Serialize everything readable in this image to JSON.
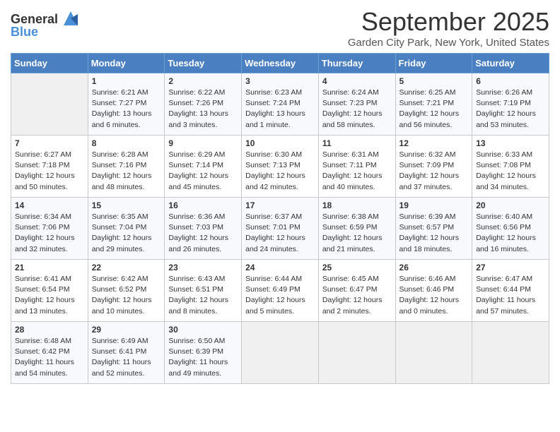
{
  "logo": {
    "general": "General",
    "blue": "Blue"
  },
  "header": {
    "month": "September 2025",
    "location": "Garden City Park, New York, United States"
  },
  "days_of_week": [
    "Sunday",
    "Monday",
    "Tuesday",
    "Wednesday",
    "Thursday",
    "Friday",
    "Saturday"
  ],
  "weeks": [
    [
      {
        "day": "",
        "info": ""
      },
      {
        "day": "1",
        "info": "Sunrise: 6:21 AM\nSunset: 7:27 PM\nDaylight: 13 hours\nand 6 minutes."
      },
      {
        "day": "2",
        "info": "Sunrise: 6:22 AM\nSunset: 7:26 PM\nDaylight: 13 hours\nand 3 minutes."
      },
      {
        "day": "3",
        "info": "Sunrise: 6:23 AM\nSunset: 7:24 PM\nDaylight: 13 hours\nand 1 minute."
      },
      {
        "day": "4",
        "info": "Sunrise: 6:24 AM\nSunset: 7:23 PM\nDaylight: 12 hours\nand 58 minutes."
      },
      {
        "day": "5",
        "info": "Sunrise: 6:25 AM\nSunset: 7:21 PM\nDaylight: 12 hours\nand 56 minutes."
      },
      {
        "day": "6",
        "info": "Sunrise: 6:26 AM\nSunset: 7:19 PM\nDaylight: 12 hours\nand 53 minutes."
      }
    ],
    [
      {
        "day": "7",
        "info": "Sunrise: 6:27 AM\nSunset: 7:18 PM\nDaylight: 12 hours\nand 50 minutes."
      },
      {
        "day": "8",
        "info": "Sunrise: 6:28 AM\nSunset: 7:16 PM\nDaylight: 12 hours\nand 48 minutes."
      },
      {
        "day": "9",
        "info": "Sunrise: 6:29 AM\nSunset: 7:14 PM\nDaylight: 12 hours\nand 45 minutes."
      },
      {
        "day": "10",
        "info": "Sunrise: 6:30 AM\nSunset: 7:13 PM\nDaylight: 12 hours\nand 42 minutes."
      },
      {
        "day": "11",
        "info": "Sunrise: 6:31 AM\nSunset: 7:11 PM\nDaylight: 12 hours\nand 40 minutes."
      },
      {
        "day": "12",
        "info": "Sunrise: 6:32 AM\nSunset: 7:09 PM\nDaylight: 12 hours\nand 37 minutes."
      },
      {
        "day": "13",
        "info": "Sunrise: 6:33 AM\nSunset: 7:08 PM\nDaylight: 12 hours\nand 34 minutes."
      }
    ],
    [
      {
        "day": "14",
        "info": "Sunrise: 6:34 AM\nSunset: 7:06 PM\nDaylight: 12 hours\nand 32 minutes."
      },
      {
        "day": "15",
        "info": "Sunrise: 6:35 AM\nSunset: 7:04 PM\nDaylight: 12 hours\nand 29 minutes."
      },
      {
        "day": "16",
        "info": "Sunrise: 6:36 AM\nSunset: 7:03 PM\nDaylight: 12 hours\nand 26 minutes."
      },
      {
        "day": "17",
        "info": "Sunrise: 6:37 AM\nSunset: 7:01 PM\nDaylight: 12 hours\nand 24 minutes."
      },
      {
        "day": "18",
        "info": "Sunrise: 6:38 AM\nSunset: 6:59 PM\nDaylight: 12 hours\nand 21 minutes."
      },
      {
        "day": "19",
        "info": "Sunrise: 6:39 AM\nSunset: 6:57 PM\nDaylight: 12 hours\nand 18 minutes."
      },
      {
        "day": "20",
        "info": "Sunrise: 6:40 AM\nSunset: 6:56 PM\nDaylight: 12 hours\nand 16 minutes."
      }
    ],
    [
      {
        "day": "21",
        "info": "Sunrise: 6:41 AM\nSunset: 6:54 PM\nDaylight: 12 hours\nand 13 minutes."
      },
      {
        "day": "22",
        "info": "Sunrise: 6:42 AM\nSunset: 6:52 PM\nDaylight: 12 hours\nand 10 minutes."
      },
      {
        "day": "23",
        "info": "Sunrise: 6:43 AM\nSunset: 6:51 PM\nDaylight: 12 hours\nand 8 minutes."
      },
      {
        "day": "24",
        "info": "Sunrise: 6:44 AM\nSunset: 6:49 PM\nDaylight: 12 hours\nand 5 minutes."
      },
      {
        "day": "25",
        "info": "Sunrise: 6:45 AM\nSunset: 6:47 PM\nDaylight: 12 hours\nand 2 minutes."
      },
      {
        "day": "26",
        "info": "Sunrise: 6:46 AM\nSunset: 6:46 PM\nDaylight: 12 hours\nand 0 minutes."
      },
      {
        "day": "27",
        "info": "Sunrise: 6:47 AM\nSunset: 6:44 PM\nDaylight: 11 hours\nand 57 minutes."
      }
    ],
    [
      {
        "day": "28",
        "info": "Sunrise: 6:48 AM\nSunset: 6:42 PM\nDaylight: 11 hours\nand 54 minutes."
      },
      {
        "day": "29",
        "info": "Sunrise: 6:49 AM\nSunset: 6:41 PM\nDaylight: 11 hours\nand 52 minutes."
      },
      {
        "day": "30",
        "info": "Sunrise: 6:50 AM\nSunset: 6:39 PM\nDaylight: 11 hours\nand 49 minutes."
      },
      {
        "day": "",
        "info": ""
      },
      {
        "day": "",
        "info": ""
      },
      {
        "day": "",
        "info": ""
      },
      {
        "day": "",
        "info": ""
      }
    ]
  ]
}
